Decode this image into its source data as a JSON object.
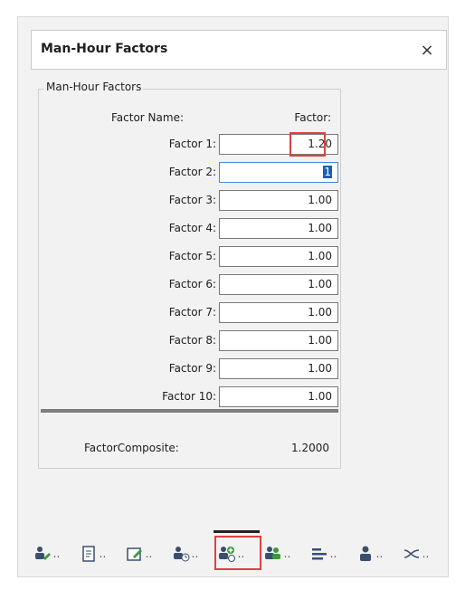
{
  "window": {
    "title": "Man-Hour Factors",
    "close_glyph": "×"
  },
  "group": {
    "title": "Man-Hour Factors"
  },
  "columns": {
    "name": "Factor Name:",
    "factor": "Factor:"
  },
  "factors": [
    {
      "label": "Factor 1:",
      "value": "1.20"
    },
    {
      "label": "Factor 2:",
      "value": "1"
    },
    {
      "label": "Factor 3:",
      "value": "1.00"
    },
    {
      "label": "Factor 4:",
      "value": "1.00"
    },
    {
      "label": "Factor 5:",
      "value": "1.00"
    },
    {
      "label": "Factor 6:",
      "value": "1.00"
    },
    {
      "label": "Factor 7:",
      "value": "1.00"
    },
    {
      "label": "Factor 8:",
      "value": "1.00"
    },
    {
      "label": "Factor 9:",
      "value": "1.00"
    },
    {
      "label": "Factor 10:",
      "value": "1.00"
    }
  ],
  "composite": {
    "label": "FactorComposite:",
    "value": "1.2000"
  },
  "toolbar": {
    "dots": "..",
    "items": [
      {
        "icon": "person-edit-icon"
      },
      {
        "icon": "document-icon"
      },
      {
        "icon": "edit-window-icon"
      },
      {
        "icon": "people-clock-icon"
      },
      {
        "icon": "people-add-clock-icon"
      },
      {
        "icon": "people-group-icon"
      },
      {
        "icon": "list-lines-icon"
      },
      {
        "icon": "single-person-icon"
      },
      {
        "icon": "shuffle-arrows-icon"
      }
    ]
  },
  "colors": {
    "accent": "#3c8ce2",
    "highlight": "#e04040",
    "selection": "#1e5fb4"
  }
}
